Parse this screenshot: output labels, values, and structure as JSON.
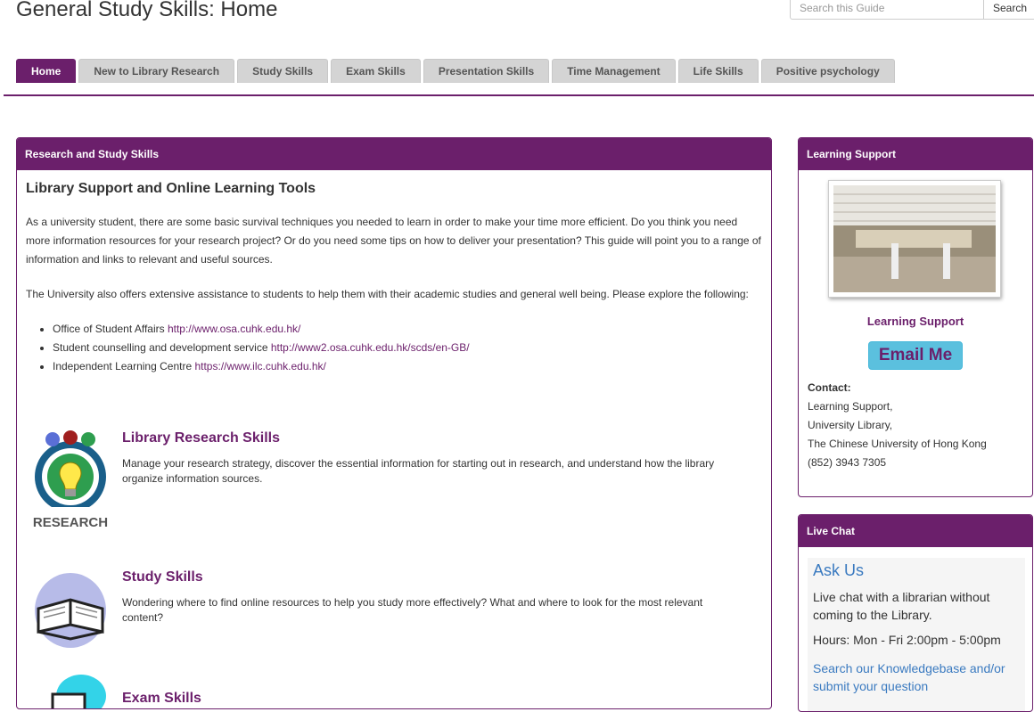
{
  "page": {
    "title": "General Study Skills: Home"
  },
  "search": {
    "placeholder": "Search this Guide",
    "button_label": "Search"
  },
  "tabs": [
    {
      "label": "Home",
      "active": true
    },
    {
      "label": "New to Library Research"
    },
    {
      "label": "Study Skills"
    },
    {
      "label": "Exam Skills"
    },
    {
      "label": "Presentation Skills"
    },
    {
      "label": "Time Management"
    },
    {
      "label": "Life Skills"
    },
    {
      "label": "Positive psychology"
    }
  ],
  "main": {
    "header": "Research and Study Skills",
    "box_title": "Library Support and Online Learning Tools",
    "para1": "As a university student, there are some basic survival techniques you needed to learn in order to make your time more efficient. Do you think you need more information resources for your research project? Or do you need some tips on how to deliver your presentation? This guide will point you to a range of information and links to relevant and useful sources.",
    "para2": "The University also offers extensive assistance to students to help them with their academic studies and general well being. Please explore the following:",
    "links": [
      {
        "text": "Office of Student Affairs ",
        "url": "http://www.osa.cuhk.edu.hk/"
      },
      {
        "text": "Student counselling and development service ",
        "url": "http://www2.osa.cuhk.edu.hk/scds/en-GB/"
      },
      {
        "text": "Independent Learning Centre ",
        "url": "https://www.ilc.cuhk.edu.hk/"
      }
    ],
    "skills": [
      {
        "title": "Library Research Skills",
        "desc": "Manage your research strategy, discover the essential information for starting out in research, and understand how the library organize information sources.",
        "icon": "research-icon",
        "icon_text": "RESEARCH"
      },
      {
        "title": "Study Skills",
        "desc": "Wondering where to find online resources to help you study more effectively?  What and where to look for the most relevant content?",
        "icon": "book-icon"
      },
      {
        "title": "Exam Skills",
        "desc": "",
        "icon": "exam-icon"
      }
    ]
  },
  "sidebar": {
    "learning_support": {
      "header": "Learning Support",
      "name": "Learning Support",
      "email_label": "Email Me",
      "contact_label": "Contact:",
      "contact_lines": [
        "Learning Support,",
        "University Library,",
        "The Chinese University of Hong Kong",
        "(852) 3943 7305"
      ]
    },
    "live_chat": {
      "header": "Live Chat",
      "ask_us": "Ask Us",
      "text": "Live chat with a librarian without coming to the Library.",
      "hours": "Hours: Mon - Fri 2:00pm - 5:00pm",
      "link": "Search our Knowledgebase and/or submit your question"
    }
  },
  "colors": {
    "brand": "#6b1f6b",
    "email_button": "#5bc0de",
    "link_blue": "#3a7ac0"
  }
}
